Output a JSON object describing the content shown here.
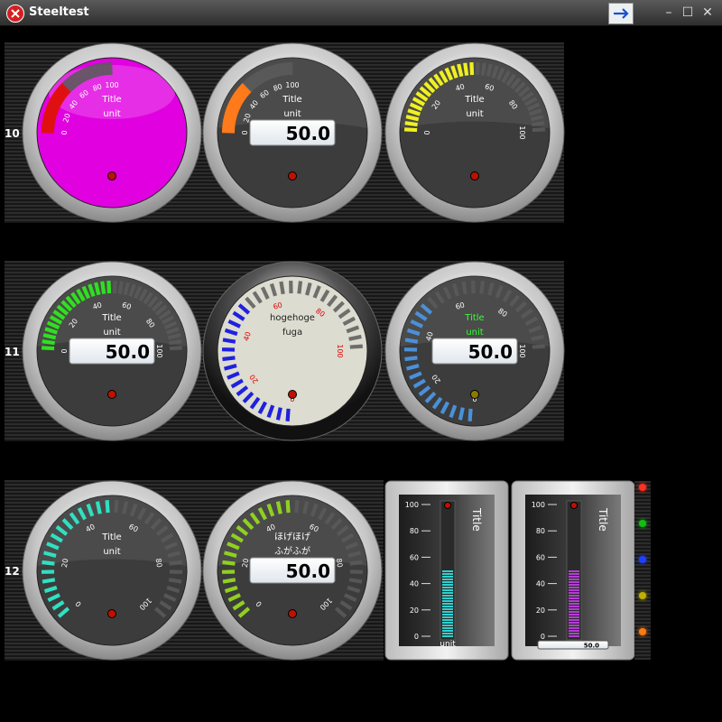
{
  "window": {
    "title": "Steeltest",
    "buttons": [
      "arrow-right-icon",
      "minimize",
      "maximize",
      "close"
    ]
  },
  "rows": [
    {
      "label": "10"
    },
    {
      "label": "11"
    },
    {
      "label": "12"
    }
  ],
  "gauges": [
    {
      "type": "quarter",
      "title": "Title",
      "unit": "unit",
      "face": "#e000e0",
      "accent": "#e01010",
      "value": 50.0,
      "lcd": false,
      "ticks": [
        "0",
        "20",
        "40",
        "60",
        "80",
        "100"
      ],
      "tick_color": "#ffffff",
      "title_color": "#ffffff",
      "led_color": "#c01000"
    },
    {
      "type": "quarter",
      "title": "Title",
      "unit": "unit",
      "face": "#3c3c3c",
      "accent": "#ff7a1a",
      "value": 50.0,
      "lcd": true,
      "lcd_text": "50.0",
      "ticks": [
        "0",
        "20",
        "40",
        "60",
        "80",
        "100"
      ],
      "tick_color": "#ffffff",
      "title_color": "#ffffff",
      "led_color": "#c01000"
    },
    {
      "type": "half",
      "title": "Title",
      "unit": "unit",
      "face": "#3c3c3c",
      "accent": "#f0f020",
      "value": 50.0,
      "lcd": false,
      "ticks": [
        "0",
        "20",
        "40",
        "60",
        "80",
        "100"
      ],
      "tick_color": "#ffffff",
      "title_color": "#ffffff",
      "led_color": "#c01000"
    },
    {
      "type": "half",
      "title": "Title",
      "unit": "unit",
      "face": "#3c3c3c",
      "accent": "#30e020",
      "value": 50.0,
      "lcd": true,
      "lcd_text": "50.0",
      "ticks": [
        "0",
        "20",
        "40",
        "60",
        "80",
        "100"
      ],
      "tick_color": "#ffffff",
      "title_color": "#ffffff",
      "led_color": "#c01000"
    },
    {
      "type": "three-quarter",
      "title": "hogehoge",
      "unit": "fuga",
      "face": "#dcdcd0",
      "accent": "#2020e0",
      "value": 50.0,
      "lcd": false,
      "ticks": [
        "0",
        "20",
        "40",
        "60",
        "80",
        "100"
      ],
      "tick_color": "#e00000",
      "title_color": "#222222",
      "led_color": "#c01000",
      "frame": "black"
    },
    {
      "type": "three-quarter",
      "title": "Title",
      "unit": "unit",
      "face": "#3c3c3c",
      "accent": "#4a90d9",
      "value": 50.0,
      "lcd": true,
      "lcd_text": "50.0",
      "ticks": [
        "0",
        "20",
        "40",
        "60",
        "80",
        "100"
      ],
      "tick_color": "#ffffff",
      "title_color": "#30ff30",
      "led_color": "#8a7a00"
    },
    {
      "type": "full",
      "title": "Title",
      "unit": "unit",
      "face": "#3c3c3c",
      "accent": "#30e0c0",
      "value": 50.0,
      "lcd": false,
      "ticks": [
        "0",
        "20",
        "40",
        "60",
        "80",
        "100"
      ],
      "tick_color": "#ffffff",
      "title_color": "#ffffff",
      "led_color": "#c01000"
    },
    {
      "type": "full",
      "title": "ほげほげ",
      "unit": "ふがふが",
      "face": "#3c3c3c",
      "accent": "#90d020",
      "value": 50.0,
      "lcd": true,
      "lcd_text": "50.0",
      "ticks": [
        "0",
        "20",
        "40",
        "60",
        "80",
        "100"
      ],
      "tick_color": "#ffffff",
      "title_color": "#ffffff",
      "led_color": "#c01000"
    }
  ],
  "bargraphs": [
    {
      "title": "Title",
      "unit": "unit",
      "value": 50,
      "color": "#30d0d0",
      "ticks": [
        "0",
        "20",
        "40",
        "60",
        "80",
        "100"
      ],
      "lcd": false
    },
    {
      "title": "Title",
      "unit": "",
      "value": 50,
      "color": "#b040d0",
      "ticks": [
        "0",
        "20",
        "40",
        "60",
        "80",
        "100"
      ],
      "lcd": true,
      "lcd_text": "50.0"
    }
  ],
  "leds": [
    "#ff3020",
    "#10c010",
    "#2040ff",
    "#c0b000",
    "#ff7a10"
  ]
}
